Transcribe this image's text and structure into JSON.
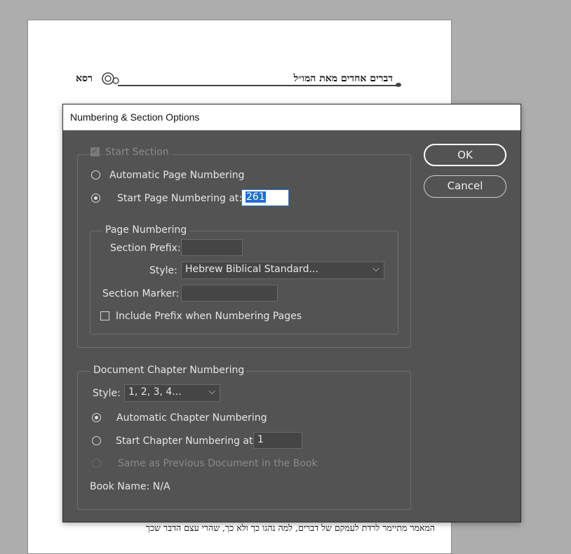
{
  "document": {
    "running_head_right": "דברים אחדים מאת המו״ל",
    "running_head_left": "רסא",
    "body_line": "המאמר מתיימר לרדת לעמקם של דברים, למה נהגו כך ולא כך, שהרי עצם הדבר שכך"
  },
  "dialog": {
    "title": "Numbering & Section Options",
    "start_section_label": "Start Section",
    "automatic_page_numbering_label": "Automatic Page Numbering",
    "start_page_numbering_label": "Start Page Numbering at:",
    "start_page_value": "261",
    "page_numbering_group": {
      "title": "Page Numbering",
      "section_prefix_label": "Section Prefix:",
      "section_prefix_value": "",
      "style_label": "Style:",
      "style_value": "Hebrew Biblical Standard...",
      "section_marker_label": "Section Marker:",
      "section_marker_value": "",
      "include_prefix_label": "Include Prefix when Numbering Pages"
    },
    "chapter_group": {
      "title": "Document Chapter Numbering",
      "style_label": "Style:",
      "style_value": "1, 2, 3, 4...",
      "automatic_chapter_label": "Automatic Chapter Numbering",
      "start_chapter_label": "Start Chapter Numbering at:",
      "start_chapter_value": "1",
      "same_as_previous_label": "Same as Previous Document in the Book",
      "book_name_label": "Book Name: N/A"
    },
    "ok_label": "OK",
    "cancel_label": "Cancel"
  }
}
